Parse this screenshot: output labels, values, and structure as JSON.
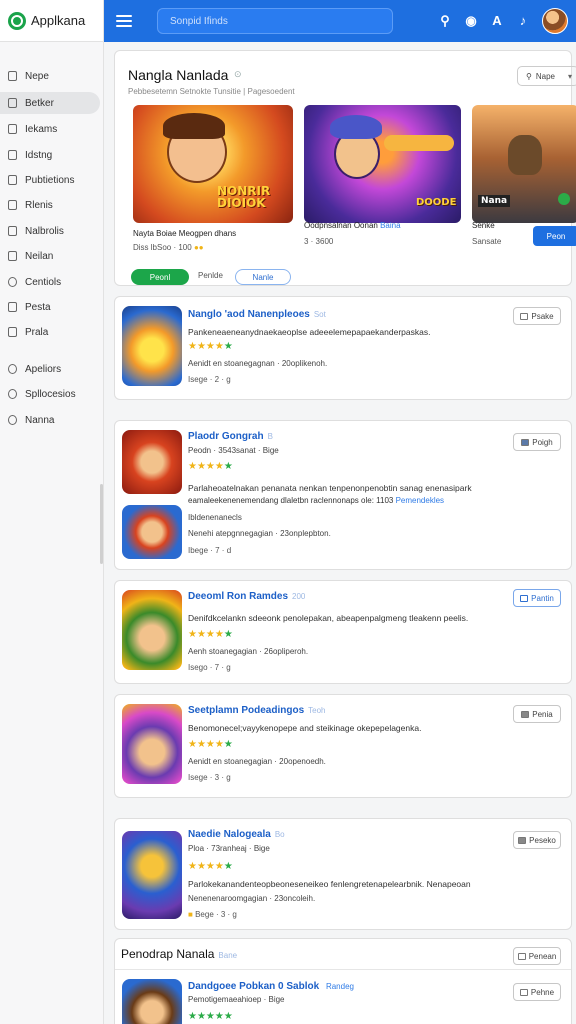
{
  "app": {
    "name": "Applkana",
    "search_placeholder": "Sonpid Ifinds"
  },
  "toolbar": {
    "icons": [
      "search-icon",
      "chat-icon",
      "translate-icon",
      "notification-icon"
    ]
  },
  "sidebar": {
    "items": [
      {
        "label": "Nepe",
        "icon": "home-icon"
      },
      {
        "label": "Betker",
        "icon": "folder-icon",
        "active": true
      },
      {
        "label": "Iekams",
        "icon": "grid-icon"
      },
      {
        "label": "Idstng",
        "icon": "calendar-icon"
      },
      {
        "label": "Pubtietions",
        "icon": "file-icon"
      },
      {
        "label": "Rlenis",
        "icon": "document-icon"
      },
      {
        "label": "Nalbrolis",
        "icon": "file-icon"
      },
      {
        "label": "Neilan",
        "icon": "file-icon"
      },
      {
        "label": "Centiols",
        "icon": "clock-icon"
      },
      {
        "label": "Pesta",
        "icon": "file-icon"
      },
      {
        "label": "Prala",
        "icon": "file-icon"
      },
      {
        "label": "Apeliors",
        "icon": "gear-icon"
      },
      {
        "label": "Spllocesios",
        "icon": "gear-icon"
      },
      {
        "label": "Nanna",
        "icon": "gear-icon"
      }
    ]
  },
  "featured": {
    "title": "Nangla Nanlada",
    "subtitle": "Pebbesetemn Setnokte Tunsitie | Pagesoedent",
    "sort_label": "Nape",
    "items": [
      {
        "name": "Nayta Boiae Meogpen dhans",
        "meta": "Diss lbSoo",
        "meta2": "100"
      },
      {
        "name": "Oodpnsalnan Oonan",
        "link": "Baina",
        "meta": "3 · 3600"
      },
      {
        "name": "Senke",
        "meta": "Sansate"
      }
    ],
    "art_text": [
      "NONRIR DIOIOK",
      "DOODE",
      "Nana"
    ],
    "primary_button": "Peonl",
    "secondary_text": "Penlde",
    "pill_label": "Nanle",
    "action_button": "Peon"
  },
  "list": [
    {
      "title": "Nanglo 'aod Nanenpleoes",
      "tag": "Sot",
      "stars": 4,
      "desc": "Pankeneaeneanydnaekaeoplse adeeelemepapaekanderpaskas.",
      "meta": "Aenidt en stoanegagnan · 20oplikenoh.",
      "foot": "Isege  ·  2  ·  g",
      "button": "Psake"
    },
    {
      "title": "Plaodr Gongrah",
      "tag": "B",
      "subtitle": "Peodn · 3543sanat · Bige",
      "stars": 4,
      "desc": "Parlaheoatelnakan penanata nenkan tenpenonpenobtin sanag enenasipark",
      "desc2": "eamaleekenenemendang dlaletbn raclennonaps ole: 1103",
      "link": "Pemendekles",
      "meta_label": "Ibldenenanecls",
      "meta": "Nenehi atepgnnegagian · 23onplepbton.",
      "foot": "Ibege  ·  7  ·  d",
      "button": "Poigh"
    },
    {
      "title": "Deeoml Ron Ramdes",
      "tag": "200",
      "stars": 4,
      "desc": "Denifdkcelankn sdeeonk penolepakan, abeapenpalgmeng tleakenn peelis.",
      "meta": "Aenh stoanegagian · 26opliperoh.",
      "foot": "Isego  ·  7  ·  g",
      "button": "Pantin",
      "blue": true
    },
    {
      "title": "Seetplamn Podeadingos",
      "tag": "Teoh",
      "stars": 4,
      "desc": "Benomonecel;vayykenopepe and steikinage okepepelagenka.",
      "meta": "Aenidt en stoanegagian · 20openoedh.",
      "foot": "Isege  ·  3  ·  g",
      "button": "Penia"
    },
    {
      "title": "Naedie Nalogeala",
      "tag": "Bo",
      "subtitle": "Ploa · 73ranheaj · Bige",
      "stars": 4,
      "desc": "Parlokekanandenteopbeoneseneikeo fenlengretenapelearbnik.  Nenapeoan",
      "meta": "Nenenenaroomgagian · 23oncoleih.",
      "foot": "Bege  ·  3  ·  g",
      "button": "Peseko"
    }
  ],
  "section": {
    "title": "Penodrap Nanala",
    "tag": "Bane",
    "button": "Penean",
    "item": {
      "title": "Dandgoee Pobkan 0 Sablok",
      "link": "Randeg",
      "subtitle": "Pemotigemaeahioep · Bige",
      "stars": 4,
      "button": "Pehne"
    }
  }
}
